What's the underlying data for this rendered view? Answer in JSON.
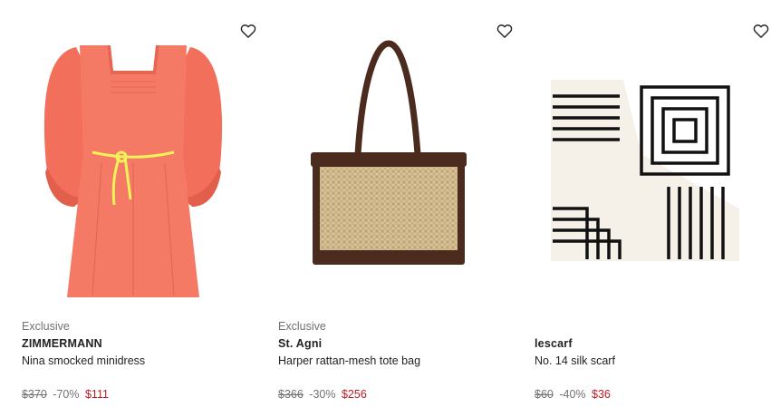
{
  "products": [
    {
      "label": "Exclusive",
      "brand": "ZIMMERMANN",
      "name": "Nina smocked minidress",
      "original_price": "$370",
      "discount": "-70%",
      "sale_price": "$111",
      "wishlist_icon": "heart-outline-icon"
    },
    {
      "label": "Exclusive",
      "brand": "St. Agni",
      "name": "Harper rattan-mesh tote bag",
      "original_price": "$366",
      "discount": "-30%",
      "sale_price": "$256",
      "wishlist_icon": "heart-outline-icon"
    },
    {
      "label": "",
      "brand": "lescarf",
      "name": "No. 14 silk scarf",
      "original_price": "$60",
      "discount": "-40%",
      "sale_price": "$36",
      "wishlist_icon": "heart-outline-icon"
    }
  ],
  "colors": {
    "sale": "#c01a24",
    "muted": "#727272",
    "text": "#222222"
  }
}
